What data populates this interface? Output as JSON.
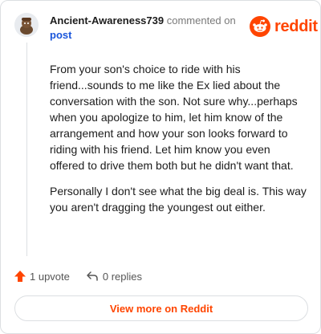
{
  "header": {
    "username": "Ancient-Awareness739",
    "action_text": "commented on",
    "post_link": "post"
  },
  "brand": {
    "name": "reddit",
    "color": "#ff4500",
    "logo_icon": "reddit-snoo-icon"
  },
  "comment": {
    "paragraphs": [
      "From your son's choice to ride with his friend...sounds to me like the Ex lied about the conversation with the son. Not sure why...perhaps when you apologize to him, let him know of the arrangement and how your son looks forward to riding with his friend. Let him know you even offered to drive them both but he didn't want that.",
      "Personally I don't see what the big deal is. This way you aren't dragging the youngest out either."
    ]
  },
  "footer": {
    "upvotes": "1 upvote",
    "replies": "0 replies",
    "view_more": "View more on Reddit"
  },
  "colors": {
    "accent": "#ff4500",
    "link": "#1a56db",
    "border": "#dcdfe2"
  }
}
